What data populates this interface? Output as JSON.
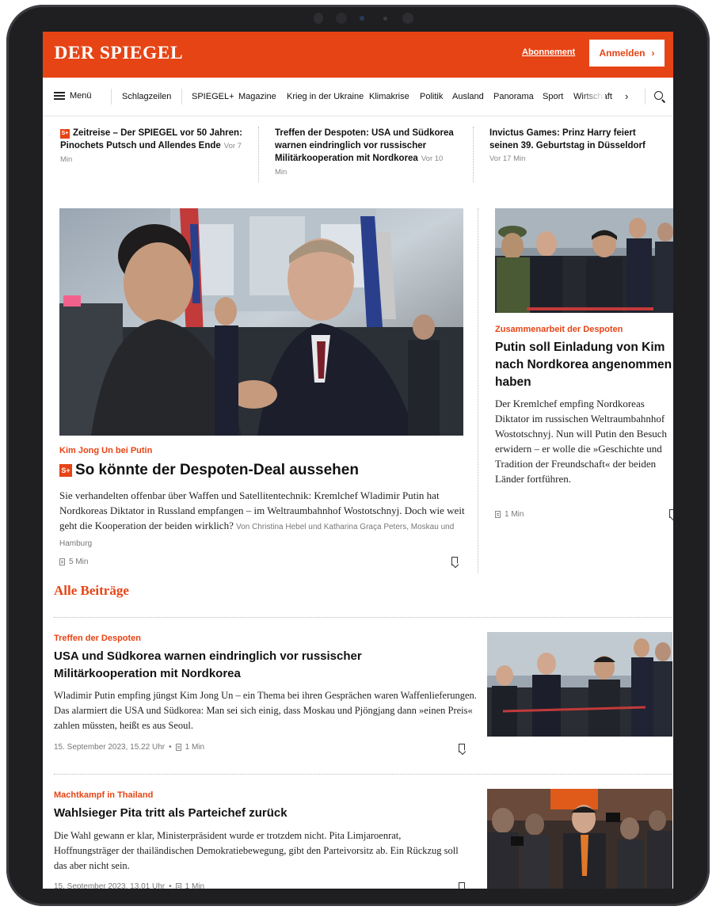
{
  "header": {
    "logo": "DER SPIEGEL",
    "subscription_label": "Abonnement",
    "login_label": "Anmelden",
    "login_arrow": "›",
    "brand_color": "#e64415"
  },
  "nav": {
    "menu_label": "Menü",
    "items": [
      "Schlagzeilen",
      "SPIEGEL+",
      "Magazine",
      "Krieg in der Ukraine",
      "Klimakrise",
      "Politik",
      "Ausland",
      "Panorama",
      "Sport",
      "Wirtschaft"
    ],
    "more_arrow": "›"
  },
  "top_teasers": [
    {
      "badge": "S+",
      "text": "Zeitreise – Der SPIEGEL vor 50 Jahren: Pinochets Putsch und Allendes Ende",
      "time": "Vor 7 Min"
    },
    {
      "text": "Treffen der Despoten: USA und Südkorea warnen eindringlich vor russischer Militärkooperation mit Nordkorea",
      "time": "Vor 10 Min"
    },
    {
      "text": "Invictus Games: Prinz Harry feiert seinen 39. Geburtstag in Düsseldorf",
      "time": "Vor 17 Min"
    }
  ],
  "lead": {
    "kicker": "Kim Jong Un bei Putin",
    "badge": "S+",
    "headline": "So könnte der Despoten-Deal aussehen",
    "body": "Sie verhandelten offenbar über Waffen und Satellitentechnik: Kremlchef Wladimir Putin hat Nordkoreas Diktator in Russland empfangen – im Weltraumbahnhof Wostotschnyj. Doch wie weit geht die Kooperation der beiden wirklich?",
    "byline": "Von Christina Hebel und Katharina Graça Peters, Moskau und Hamburg",
    "read_time": "5 Min"
  },
  "side": {
    "kicker": "Zusammenarbeit der Despoten",
    "headline": "Putin soll Einladung von Kim nach Nordkorea angenommen haben",
    "body": "Der Kremlchef empfing Nordkoreas Diktator im russischen Weltraumbahnhof Wostotschnyj. Nun will Putin den Besuch erwidern – er wolle die »Geschichte und Tradition der Freundschaft« der beiden Länder fortführen.",
    "read_time": "1 Min"
  },
  "all_posts": {
    "title": "Alle Beiträge",
    "items": [
      {
        "kicker": "Treffen der Despoten",
        "headline": "USA und Südkorea warnen eindringlich vor russischer Militärkooperation mit Nordkorea",
        "body": "Wladimir Putin empfing jüngst Kim Jong Un – ein Thema bei ihren Gesprächen waren Waffenlieferungen. Das alarmiert die USA und Südkorea: Man sei sich einig, dass Moskau und Pjöngjang dann »einen Preis« zahlen müssten, heißt es aus Seoul.",
        "date": "15. September 2023, 15.22 Uhr",
        "separator": "•",
        "read_time": "1 Min"
      },
      {
        "kicker": "Machtkampf in Thailand",
        "headline": "Wahlsieger Pita tritt als Parteichef zurück",
        "body": "Die Wahl gewann er klar, Ministerpräsident wurde er trotzdem nicht. Pita Limjaroenrat, Hoffnungsträger der thailändischen Demokratiebewegung, gibt den Parteivorsitz ab. Ein Rückzug soll das aber nicht sein.",
        "date": "15. September 2023, 13.01 Uhr",
        "separator": "•",
        "read_time": "1 Min"
      }
    ]
  }
}
